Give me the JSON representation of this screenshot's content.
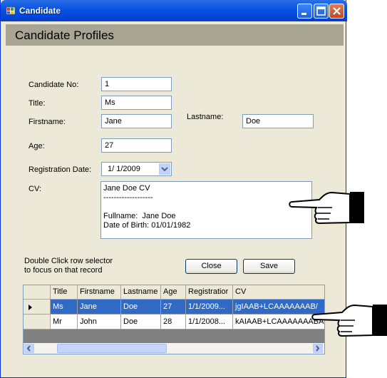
{
  "window": {
    "title": "Candidate"
  },
  "header": {
    "title": "Candidate Profiles"
  },
  "form": {
    "candidate_no": {
      "label": "Candidate No:",
      "value": "1"
    },
    "title": {
      "label": "Title:",
      "value": "Ms"
    },
    "firstname": {
      "label": "Firstname:",
      "value": "Jane"
    },
    "lastname": {
      "label": "Lastname:",
      "value": "Doe"
    },
    "age": {
      "label": "Age:",
      "value": "27"
    },
    "registration_date": {
      "label": "Registration Date:",
      "value": "1/ 1/2009"
    },
    "cv": {
      "label": "CV:",
      "value": "Jane Doe CV\n-------------------\n\nFullname:  Jane Doe\nDate of Birth: 01/01/1982"
    }
  },
  "hint": {
    "line1": "Double Click row selector",
    "line2": "to focus on that record"
  },
  "buttons": {
    "close": "Close",
    "save": "Save"
  },
  "grid": {
    "columns": [
      "Title",
      "Firstname",
      "Lastname",
      "Age",
      "Registratior",
      "CV"
    ],
    "rows": [
      [
        "Ms",
        "Jane",
        "Doe",
        "27",
        "1/1/2009...",
        "jgIAAB+LCAAAAAAAB/"
      ],
      [
        "Mr",
        "John",
        "Doe",
        "28",
        "1/1/2008...",
        "kAIAAB+LCAAAAAAABAD"
      ]
    ],
    "selected_row": 0
  },
  "colors": {
    "titlebar": "#0054e3",
    "selection": "#316ac5",
    "header": "#a8a592"
  },
  "icons": [
    "app-icon",
    "minimize-icon",
    "maximize-icon",
    "close-icon",
    "dropdown-arrow-icon",
    "row-pointer-icon",
    "pointing-hand-icon"
  ]
}
